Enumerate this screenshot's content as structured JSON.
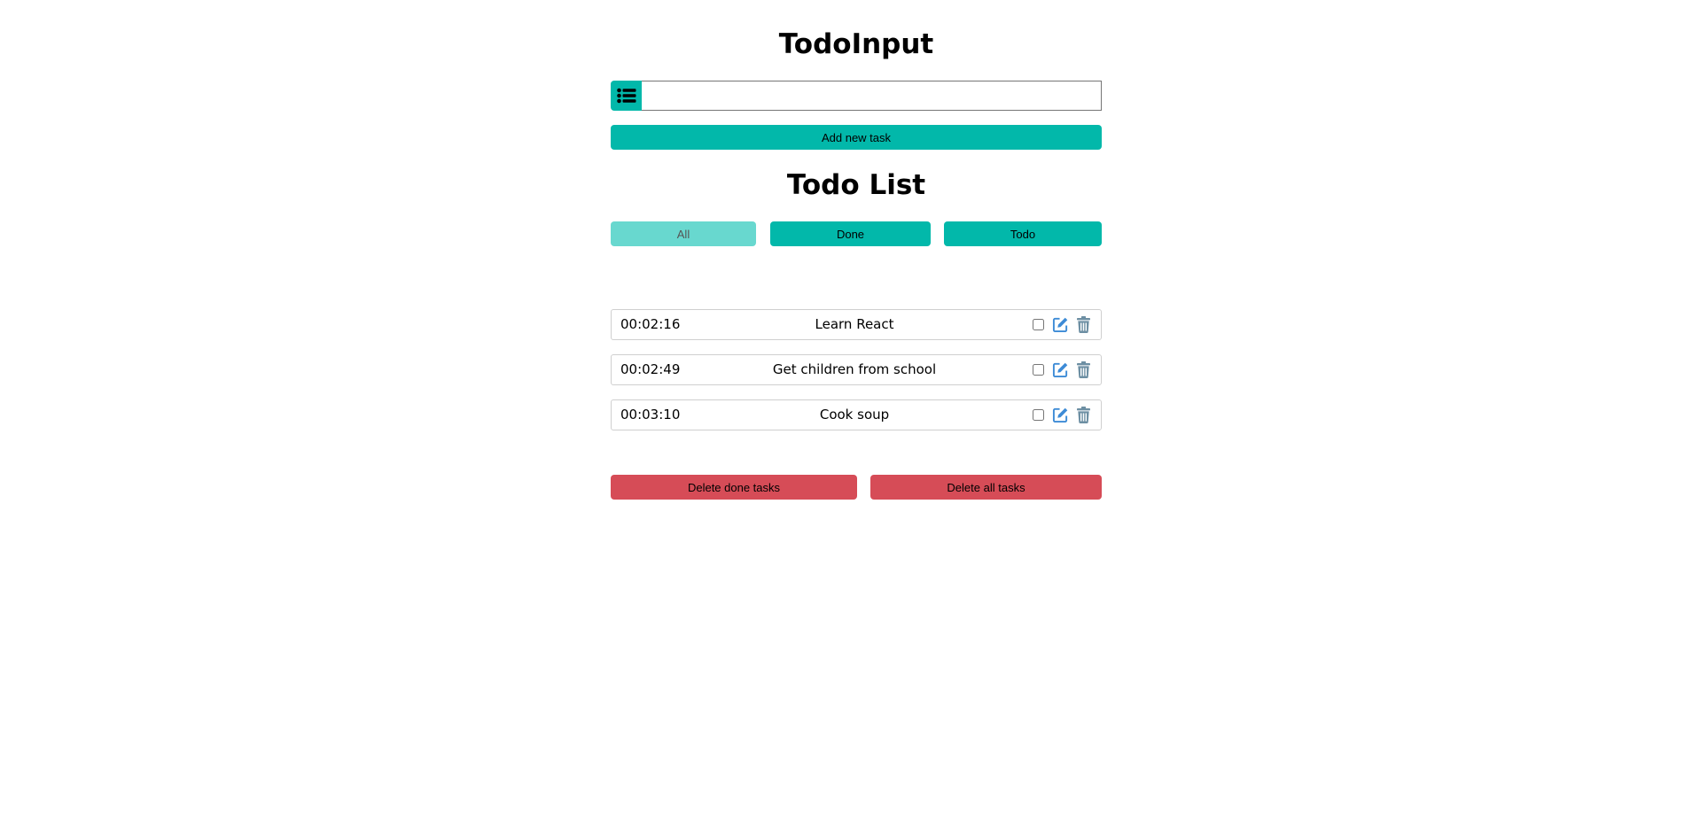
{
  "input_section": {
    "title": "TodoInput",
    "input_value": "",
    "add_button_label": "Add new task"
  },
  "list_section": {
    "title": "Todo List",
    "filters": [
      {
        "label": "All",
        "active": true
      },
      {
        "label": "Done",
        "active": false
      },
      {
        "label": "Todo",
        "active": false
      }
    ],
    "tasks": [
      {
        "time": "00:02:16",
        "name": "Learn React",
        "done": false
      },
      {
        "time": "00:02:49",
        "name": "Get children from school",
        "done": false
      },
      {
        "time": "00:03:10",
        "name": "Cook soup",
        "done": false
      }
    ]
  },
  "footer": {
    "delete_done_label": "Delete done tasks",
    "delete_all_label": "Delete all tasks"
  },
  "colors": {
    "accent": "#02b8aa",
    "accent_active": "#68d8cf",
    "danger": "#d64c57",
    "edit_icon": "#3d8bd6",
    "trash_icon": "#6d8fa3"
  },
  "icons": {
    "input_prefix": "list-icon",
    "edit": "pencil-square-icon",
    "delete": "trash-icon"
  }
}
